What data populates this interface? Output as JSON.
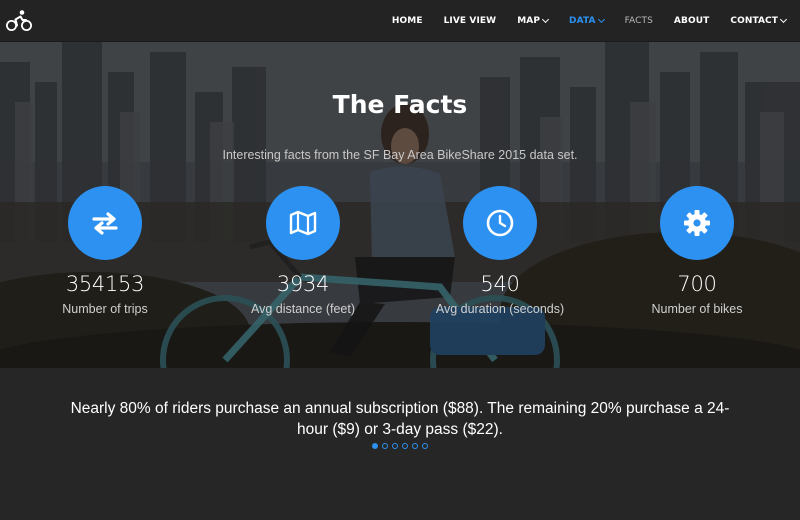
{
  "nav": {
    "items": [
      {
        "label": "HOME",
        "dropdown": false,
        "state": "normal"
      },
      {
        "label": "LIVE VIEW",
        "dropdown": false,
        "state": "normal"
      },
      {
        "label": "MAP",
        "dropdown": true,
        "state": "normal"
      },
      {
        "label": "DATA",
        "dropdown": true,
        "state": "active"
      },
      {
        "label": "FACTS",
        "dropdown": false,
        "state": "current"
      },
      {
        "label": "ABOUT",
        "dropdown": false,
        "state": "normal"
      },
      {
        "label": "CONTACT",
        "dropdown": true,
        "state": "normal"
      }
    ]
  },
  "hero": {
    "title": "The Facts",
    "subtitle": "Interesting facts from the SF Bay Area BikeShare 2015 data set."
  },
  "stats": [
    {
      "icon": "swap-arrows-icon",
      "value": "354153",
      "label": "Number of trips"
    },
    {
      "icon": "map-icon",
      "value": "3934",
      "label": "Avg distance (feet)"
    },
    {
      "icon": "clock-icon",
      "value": "540",
      "label": "Avg duration (seconds)"
    },
    {
      "icon": "gear-icon",
      "value": "700",
      "label": "Number of bikes"
    }
  ],
  "carousel": {
    "text": "Nearly 80% of riders purchase an annual subscription ($88). The remaining 20% purchase a 24-hour ($9) or 3-day pass ($22).",
    "dot_count": 6,
    "active_dot": 0
  },
  "colors": {
    "accent": "#2c91f0",
    "navbar": "#232323",
    "background": "#262626"
  }
}
